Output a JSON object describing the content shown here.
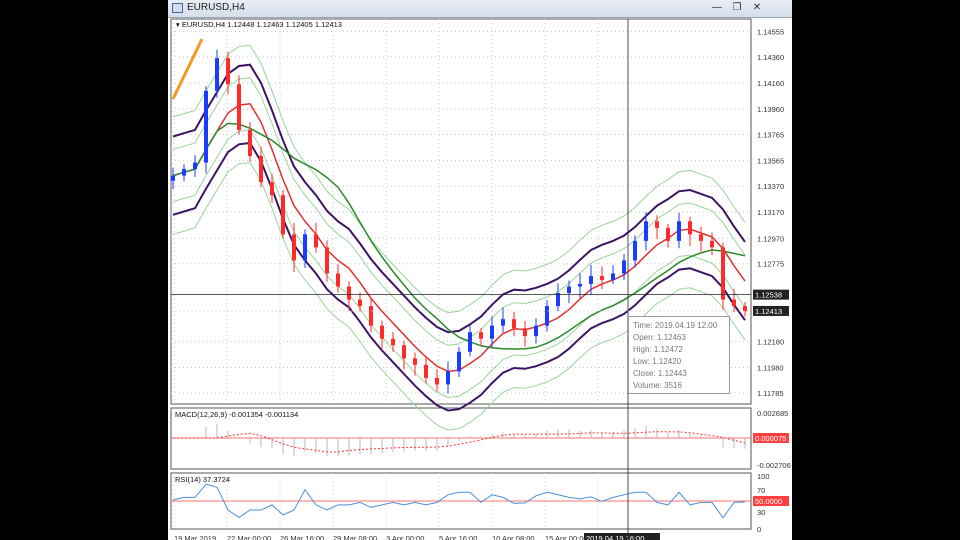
{
  "window": {
    "title": "EURUSD,H4",
    "buttons": {
      "minimize": "—",
      "restore": "❐",
      "close": "✕"
    }
  },
  "colors": {
    "bg": "#ffffff",
    "grid": "#c8c8c8",
    "bull": "#1a3cff",
    "bear": "#ff2a2a",
    "bb_outer": "#3c1466",
    "bb_thin": "#9bd49b",
    "ma_red": "#e03030",
    "ma_green": "#2a8a2a",
    "macd_hist": "#b8b8b8",
    "macd_signal": "#ff3030",
    "rsi": "#4a90d9",
    "level": "#ff4040",
    "trend": "#f09a2a"
  },
  "chart_data": [
    {
      "type": "candlestick",
      "symbol": "EURUSD",
      "timeframe": "H4",
      "header": "EURUSD,H4  1.12448 1.12463 1.12405 1.12413",
      "ylim": [
        1.117,
        1.1465
      ],
      "y_ticks": [
        "1.14555",
        "1.14360",
        "1.14160",
        "1.13960",
        "1.13765",
        "1.13565",
        "1.13370",
        "1.13170",
        "1.12970",
        "1.12775",
        "1.12180",
        "1.11980",
        "1.11785"
      ],
      "price_labels": [
        "1.12538",
        "1.12413"
      ],
      "crosshair_price": 1.12538,
      "last_price": 1.12413,
      "ohlc_close_path": [
        1.1345,
        1.135,
        1.1355,
        1.141,
        1.1435,
        1.1415,
        1.138,
        1.136,
        1.134,
        1.133,
        1.13,
        1.128,
        1.13,
        1.129,
        1.127,
        1.126,
        1.125,
        1.1245,
        1.123,
        1.122,
        1.1215,
        1.1205,
        1.12,
        1.119,
        1.1185,
        1.1195,
        1.121,
        1.1225,
        1.122,
        1.123,
        1.1235,
        1.1228,
        1.1222,
        1.123,
        1.1245,
        1.1255,
        1.126,
        1.1262,
        1.1268,
        1.1265,
        1.127,
        1.128,
        1.1295,
        1.131,
        1.1305,
        1.1295,
        1.131,
        1.13,
        1.1295,
        1.129,
        1.125,
        1.1245,
        1.1241
      ],
      "tooltip": {
        "time": "Time: 2019.04.19 12:00",
        "open": "Open: 1.12463",
        "high": "High: 1.12472",
        "low": "Low: 1.12420",
        "close": "Close: 1.12443",
        "volume": "Volume: 3516"
      },
      "x_labels": [
        "19 Mar 2019",
        "22 Mar 00:00",
        "26 Mar 16:00",
        "29 Mar 08:00",
        "3 Apr 00:00",
        "5 Apr 16:00",
        "10 Apr 08:00",
        "15 Apr 00:00",
        "2019.04.19 16:00"
      ]
    },
    {
      "type": "bar",
      "name": "MACD(12,26,9)",
      "header": "MACD(12,26,9) -0.001354 -0.001134",
      "y_ticks": [
        "0.002685",
        "-0.002706"
      ],
      "level_label": "0.000075"
    },
    {
      "type": "line",
      "name": "RSI(14)",
      "header": "RSI(14) 37.3724",
      "ylim": [
        0,
        100
      ],
      "y_ticks": [
        "100",
        "70",
        "30",
        "0"
      ],
      "level_label": "50.0000"
    }
  ]
}
